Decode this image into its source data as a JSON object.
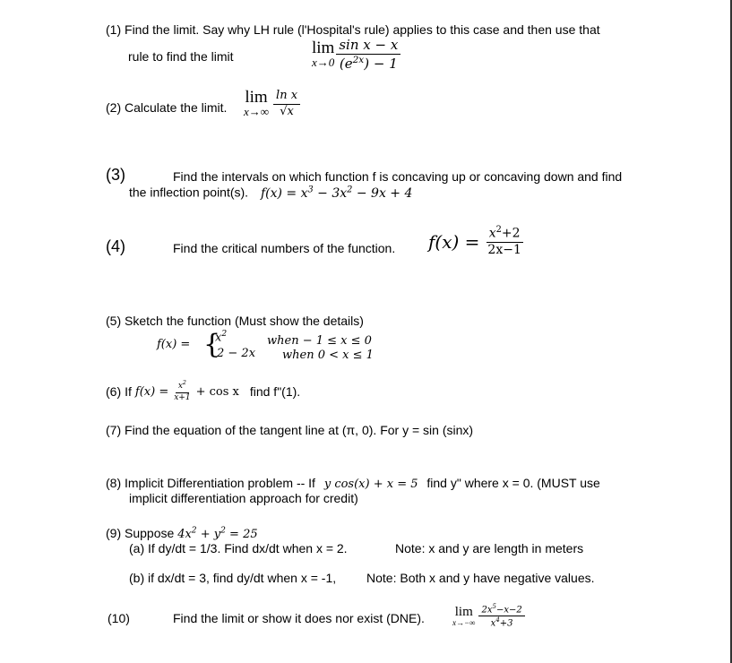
{
  "problems": {
    "p1": {
      "number": "(1)",
      "text_line1": "Find the limit.   Say why LH rule (l'Hospital's rule) applies to this case and then use that",
      "text_line2": "rule to find the limit",
      "lim": "lim",
      "lim_sub": "x→0",
      "numerator": "sin x − x",
      "denominator_base": "(e",
      "denominator_exp": "2x",
      "denominator_rest": ") − 1"
    },
    "p2": {
      "number": "(2)",
      "text": "Calculate the limit.",
      "lim": "lim",
      "lim_sub": "x→∞",
      "numerator": "ln x",
      "denominator": "√x"
    },
    "p3": {
      "number": "(3)",
      "text_line1": "Find the intervals on which function f is concaving up or concaving down and find",
      "text_line2": "the inflection point(s).",
      "formula_prefix": "f(x) = x",
      "exp1": "3",
      "mid": " − 3x",
      "exp2": "2",
      "formula_suffix": "  − 9x + 4"
    },
    "p4": {
      "number": "(4)",
      "text": "Find the critical numbers of the function.",
      "formula_lhs": "f(x) =",
      "numerator_base": "x",
      "numerator_exp": "2",
      "numerator_rest": "+2",
      "denominator": "2x−1"
    },
    "p5": {
      "number": "(5)",
      "text": "Sketch the function (Must show the details)",
      "lhs": "f(x) =",
      "case1_expr": "x",
      "case1_exp": "2",
      "case1_cond": "when  − 1 ≤ x  ≤ 0",
      "case2_expr": "2 − 2x",
      "case2_cond": "when 0 < x ≤ 1"
    },
    "p6": {
      "number": "(6)",
      "text_if": "If",
      "lhs": "f(x) =",
      "numerator_base": "x",
      "numerator_exp": "2",
      "denominator": "x+1",
      "rest": "+ cos x",
      "find": "find f\"(1)."
    },
    "p7": {
      "number": "(7)",
      "text": "Find the equation of the tangent line at (π, 0).  For y = sin (sinx)"
    },
    "p8": {
      "number": "(8)",
      "text_a": "Implicit Differentiation problem --    If",
      "formula": "y cos(x) + x = 5",
      "text_b": "find y\" where x = 0.  (MUST use",
      "text_line2": "implicit differentiation approach for credit)"
    },
    "p9": {
      "number": "(9)",
      "text": "Suppose",
      "formula_a": "4x",
      "exp_a": "2",
      "formula_b": " + y",
      "exp_b": "2",
      "formula_c": " = 25",
      "part_a": "(a) If dy/dt = 1/3. Find dx/dt when x = 2.",
      "note_a": "Note:   x and y are length in meters",
      "part_b": "(b) if dx/dt = 3, find dy/dt when x = -1,",
      "note_b": "Note:   Both x and y have negative values."
    },
    "p10": {
      "number": "(10)",
      "text": "Find the limit or show it does nor exist (DNE).",
      "lim": "lim",
      "lim_sub": "x→−∞",
      "numerator_a": "2x",
      "numerator_exp": "5",
      "numerator_b": "−x−2",
      "denominator_a": "x",
      "denominator_exp": "4",
      "denominator_b": "+3"
    }
  }
}
